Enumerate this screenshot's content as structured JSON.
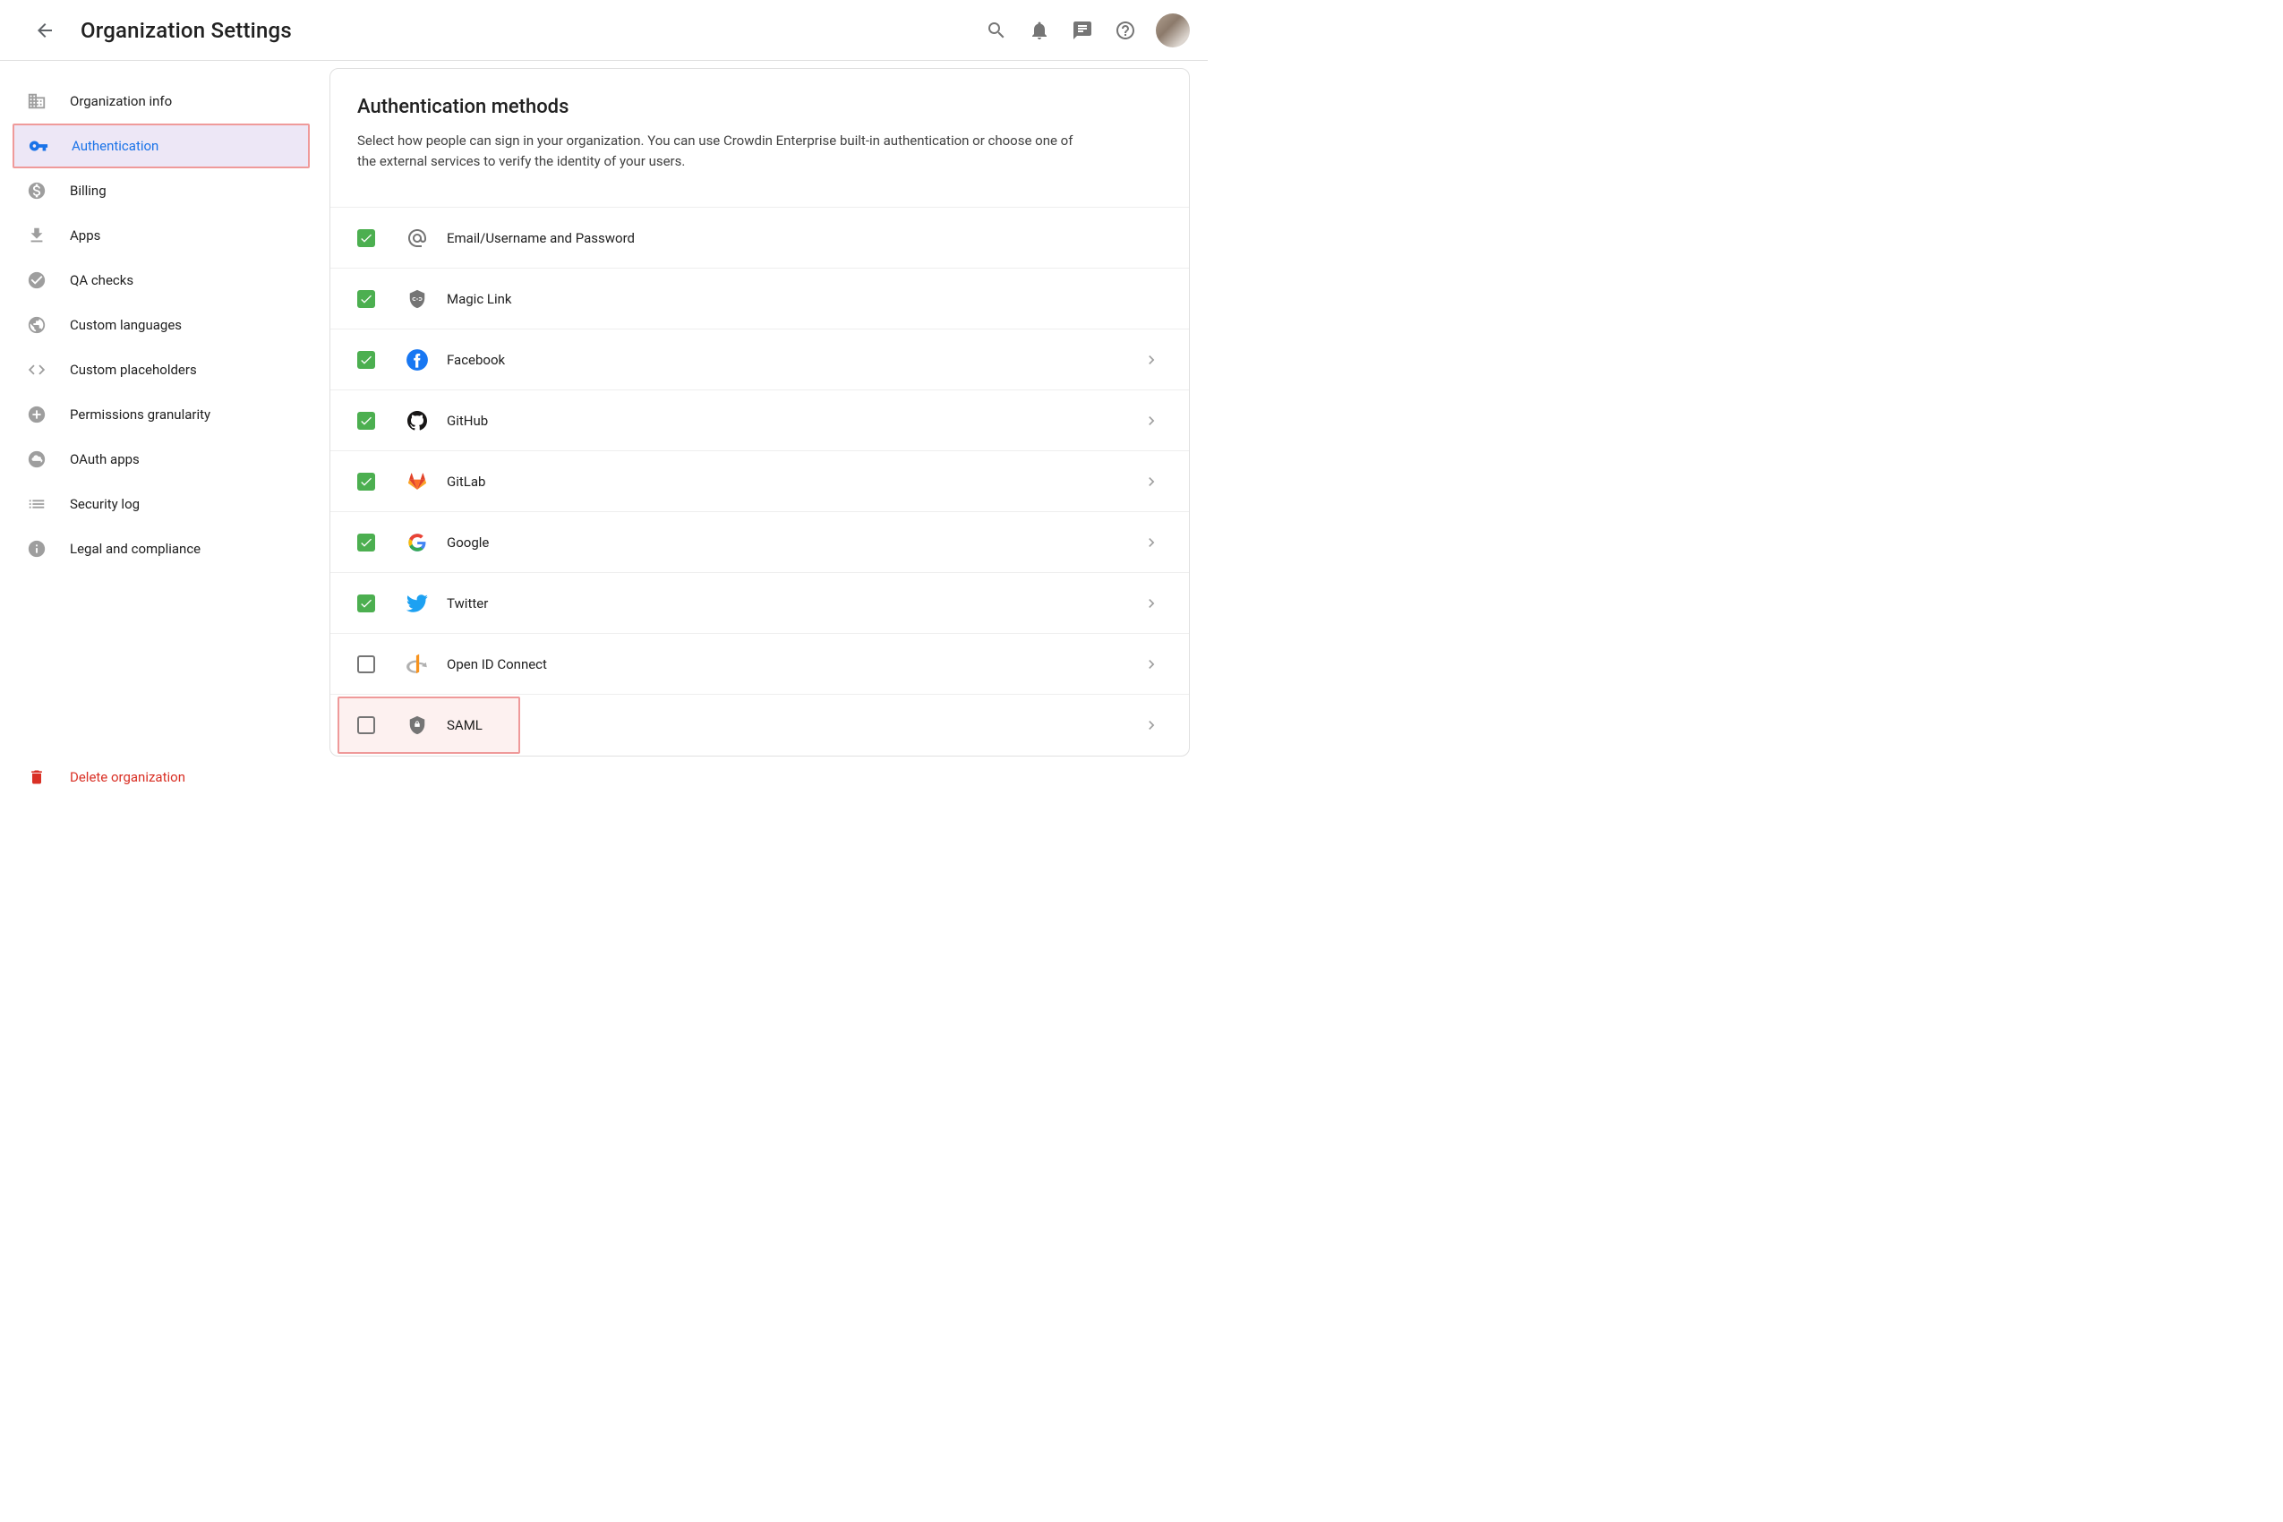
{
  "header": {
    "title": "Organization Settings"
  },
  "sidebar": {
    "items": [
      {
        "label": "Organization info"
      },
      {
        "label": "Authentication"
      },
      {
        "label": "Billing"
      },
      {
        "label": "Apps"
      },
      {
        "label": "QA checks"
      },
      {
        "label": "Custom languages"
      },
      {
        "label": "Custom placeholders"
      },
      {
        "label": "Permissions granularity"
      },
      {
        "label": "OAuth apps"
      },
      {
        "label": "Security log"
      },
      {
        "label": "Legal and compliance"
      }
    ],
    "delete_label": "Delete organization"
  },
  "main": {
    "title": "Authentication methods",
    "description": "Select how people can sign in your organization. You can use Crowdin Enterprise built-in authentication or choose one of the external services to verify the identity of your users.",
    "methods": [
      {
        "label": "Email/Username and Password",
        "checked": true,
        "arrow": false
      },
      {
        "label": "Magic Link",
        "checked": true,
        "arrow": false
      },
      {
        "label": "Facebook",
        "checked": true,
        "arrow": true
      },
      {
        "label": "GitHub",
        "checked": true,
        "arrow": true
      },
      {
        "label": "GitLab",
        "checked": true,
        "arrow": true
      },
      {
        "label": "Google",
        "checked": true,
        "arrow": true
      },
      {
        "label": "Twitter",
        "checked": true,
        "arrow": true
      },
      {
        "label": "Open ID Connect",
        "checked": false,
        "arrow": true
      },
      {
        "label": "SAML",
        "checked": false,
        "arrow": true
      }
    ]
  }
}
